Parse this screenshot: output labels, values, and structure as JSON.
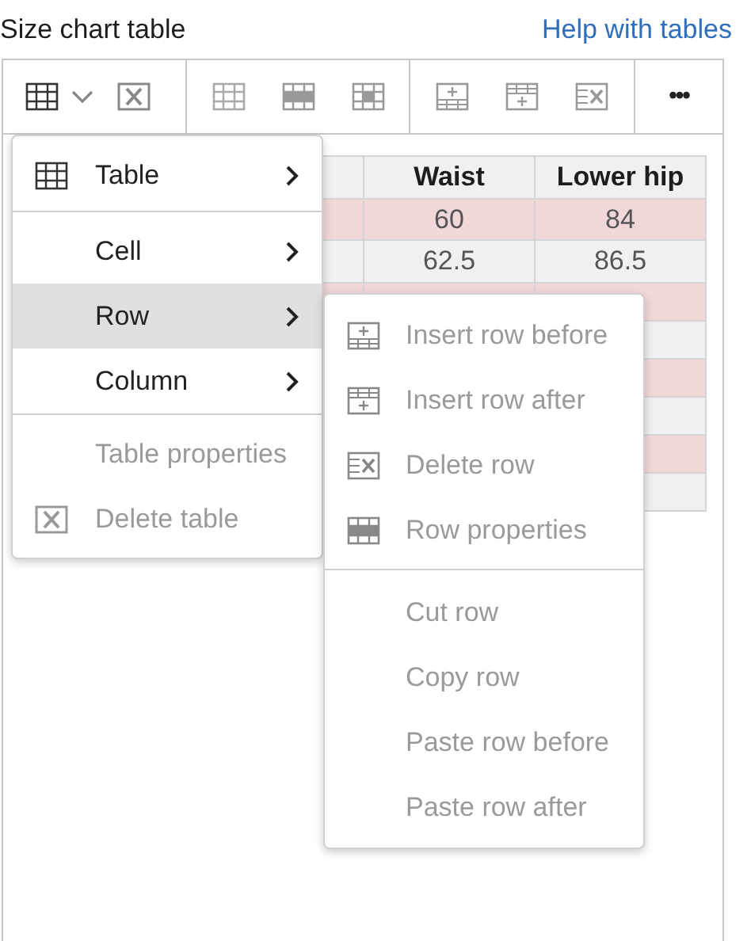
{
  "header": {
    "title": "Size chart table",
    "help_link": "Help with tables"
  },
  "toolbar": {
    "more": "•••"
  },
  "table": {
    "columns": [
      "",
      "Waist",
      "Lower hip"
    ],
    "rows": [
      {
        "cells": [
          "",
          "60",
          "84"
        ],
        "highlighted": true
      },
      {
        "cells": [
          "",
          "62.5",
          "86.5"
        ],
        "highlighted": false
      },
      {
        "highlighted": true
      },
      {
        "highlighted": false
      },
      {
        "highlighted": true
      },
      {
        "highlighted": false
      },
      {
        "highlighted": true
      },
      {
        "highlighted": false
      }
    ]
  },
  "menu": {
    "groups": [
      [
        {
          "label": "Table",
          "submenu": true,
          "selected": false,
          "disabled": false
        }
      ],
      [
        {
          "label": "Cell",
          "submenu": true,
          "selected": false,
          "disabled": false
        },
        {
          "label": "Row",
          "submenu": true,
          "selected": true,
          "disabled": false
        },
        {
          "label": "Column",
          "submenu": true,
          "selected": false,
          "disabled": false
        }
      ],
      [
        {
          "label": "Table properties",
          "submenu": false,
          "selected": false,
          "disabled": true
        },
        {
          "label": "Delete table",
          "submenu": false,
          "selected": false,
          "disabled": true
        }
      ]
    ]
  },
  "submenu": {
    "groups": [
      [
        {
          "label": "Insert row before",
          "disabled": true
        },
        {
          "label": "Insert row after",
          "disabled": true
        },
        {
          "label": "Delete row",
          "disabled": true
        },
        {
          "label": "Row properties",
          "disabled": true
        }
      ],
      [
        {
          "label": "Cut row",
          "disabled": true
        },
        {
          "label": "Copy row",
          "disabled": true
        },
        {
          "label": "Paste row before",
          "disabled": true
        },
        {
          "label": "Paste row after",
          "disabled": true
        }
      ]
    ]
  }
}
